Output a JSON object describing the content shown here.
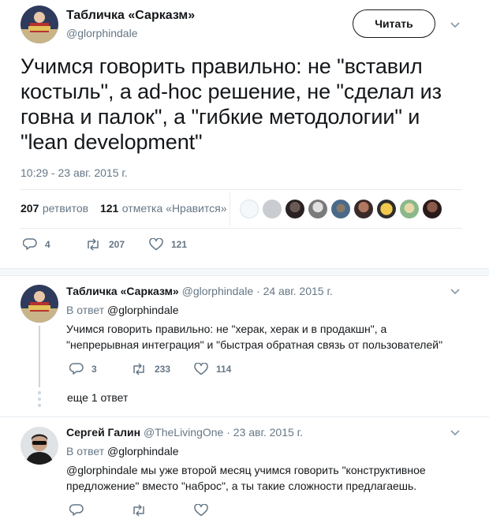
{
  "main_tweet": {
    "author_name": "Табличка «Сарказм»",
    "author_handle": "@glorphindale",
    "follow_label": "Читать",
    "text": "Учимся говорить правильно: не \"вставил костыль\", а ad-hoc решение, не \"сделал из говна и палок\", а \"гибкие методологии\" и \"lean development\"",
    "timestamp": "10:29 - 23 авг. 2015 г.",
    "retweets_count": "207",
    "retweets_label": "ретвитов",
    "likes_count": "121",
    "likes_label": "отметка «Нравится»",
    "actions": {
      "reply": "4",
      "retweet": "207",
      "like": "121"
    }
  },
  "replies": [
    {
      "author_name": "Табличка «Сарказм»",
      "author_handle": "@glorphindale",
      "date": "· 24 авг. 2015 г.",
      "in_reply_label": "В ответ",
      "in_reply_to": "@glorphindale",
      "text": "Учимся говорить правильно: не \"херак, херак и в продакшн\", а \"непрерывная интеграция\" и \"быстрая обратная связь от пользователей\"",
      "actions": {
        "reply": "3",
        "retweet": "233",
        "like": "114"
      },
      "more_label": "еще 1 ответ"
    },
    {
      "author_name": "Сергей Галин",
      "author_handle": "@TheLivingOne",
      "date": "· 23 авг. 2015 г.",
      "in_reply_label": "В ответ",
      "in_reply_to": "@glorphindale",
      "text": "@glorphindale мы уже второй месяц учимся говорить \"конструктивное предложение\" вместо \"наброс\", а ты такие сложности предлагаешь.",
      "actions": {
        "reply": "",
        "retweet": "",
        "like": ""
      }
    }
  ],
  "icons": {
    "reply": "reply-bubble-icon",
    "retweet": "retweet-arrows-icon",
    "like": "heart-outline-icon",
    "chevron": "chevron-down-icon"
  },
  "colors": {
    "text": "#14171a",
    "muted": "#657786",
    "divider": "#e6ecf0",
    "thread_line": "#ccd6dd"
  }
}
